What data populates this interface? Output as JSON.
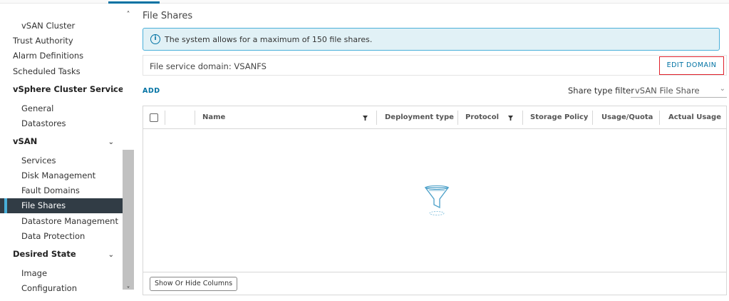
{
  "sidebar": {
    "items": [
      {
        "label": "vSAN Cluster",
        "level": 2
      },
      {
        "label": "Trust Authority",
        "level": 1
      },
      {
        "label": "Alarm Definitions",
        "level": 1
      },
      {
        "label": "Scheduled Tasks",
        "level": 1
      },
      {
        "label": "vSphere Cluster Service",
        "level": "section"
      },
      {
        "label": "General",
        "level": 2
      },
      {
        "label": "Datastores",
        "level": 2
      },
      {
        "label": "vSAN",
        "level": "section"
      },
      {
        "label": "Services",
        "level": 2
      },
      {
        "label": "Disk Management",
        "level": 2
      },
      {
        "label": "Fault Domains",
        "level": 2
      },
      {
        "label": "File Shares",
        "level": 2,
        "active": true
      },
      {
        "label": "Datastore Management",
        "level": 2
      },
      {
        "label": "Data Protection",
        "level": 2
      },
      {
        "label": "Desired State",
        "level": "section"
      },
      {
        "label": "Image",
        "level": 2
      },
      {
        "label": "Configuration",
        "level": 2
      }
    ]
  },
  "main": {
    "title": "File Shares",
    "alert_text": "The system allows for a maximum of 150 file shares.",
    "domain_text": "File service domain: VSANFS",
    "edit_domain_label": "EDIT DOMAIN",
    "add_label": "ADD",
    "filter_label": "Share type filter",
    "filter_value": "vSAN File Share"
  },
  "grid": {
    "columns": [
      "Name",
      "Deployment type",
      "Protocol",
      "Storage Policy",
      "Usage/Quota",
      "Actual Usage"
    ],
    "show_hide_label": "Show Or Hide Columns"
  },
  "colors": {
    "accent": "#0072a3",
    "active_nav_bg": "#313c45",
    "alert_bg": "#e1f1f6",
    "highlight_border": "#e0212b"
  }
}
